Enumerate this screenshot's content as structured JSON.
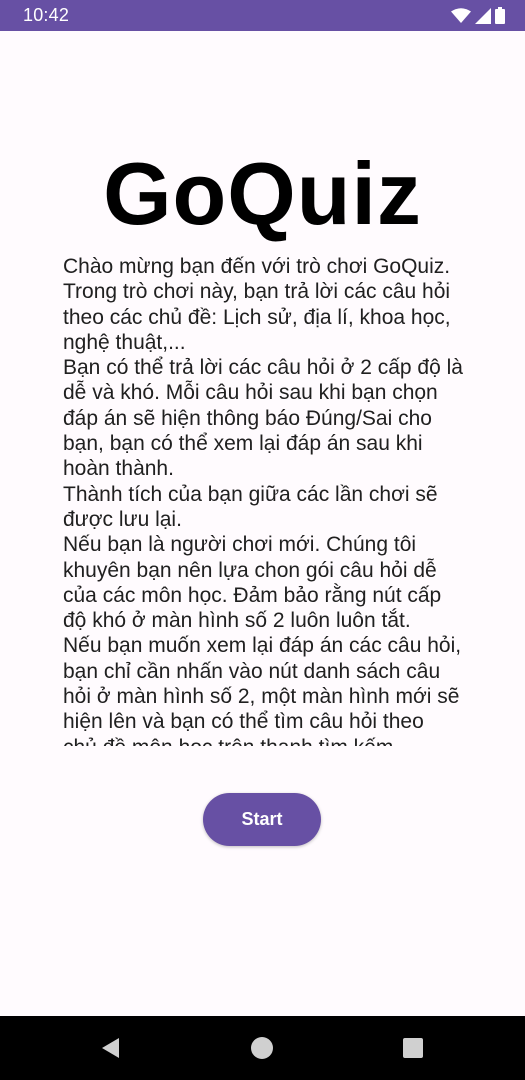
{
  "status_bar": {
    "time": "10:42",
    "icons": [
      "wifi-icon",
      "cell-signal-icon",
      "battery-icon"
    ],
    "background": "#6750a4"
  },
  "main": {
    "title": "GoQuiz",
    "intro_text": "Chào mừng bạn đến với trò chơi GoQuiz. Trong trò chơi này, bạn trả lời các câu hỏi theo các chủ đề: Lịch sử, địa lí, khoa học, nghệ thuật,...\nBạn có thể trả lời các câu hỏi ở 2 cấp độ là dễ và khó. Mỗi câu hỏi sau khi bạn chọn đáp án sẽ hiện thông báo Đúng/Sai cho bạn, bạn có thể xem lại đáp án sau khi hoàn thành.\nThành tích của bạn giữa các lần chơi sẽ được lưu lại.\nNếu bạn là người chơi mới. Chúng tôi khuyên bạn nên lựa chon gói câu hỏi dễ của các môn học. Đảm bảo rằng nút cấp độ khó ở màn hình số 2 luôn luôn tắt.\nNếu bạn muốn xem lại đáp án các câu hỏi, bạn chỉ cần nhấn vào nút danh sách câu hỏi ở màn hình số 2, một màn hình mới sẽ hiện lên và bạn có thể tìm câu hỏi theo chủ đề môn học trên thanh tìm kếm",
    "start_label": "Start",
    "accent": "#6750a4"
  },
  "nav_bar": {
    "icons": [
      "back-icon",
      "home-icon",
      "recents-icon"
    ]
  }
}
